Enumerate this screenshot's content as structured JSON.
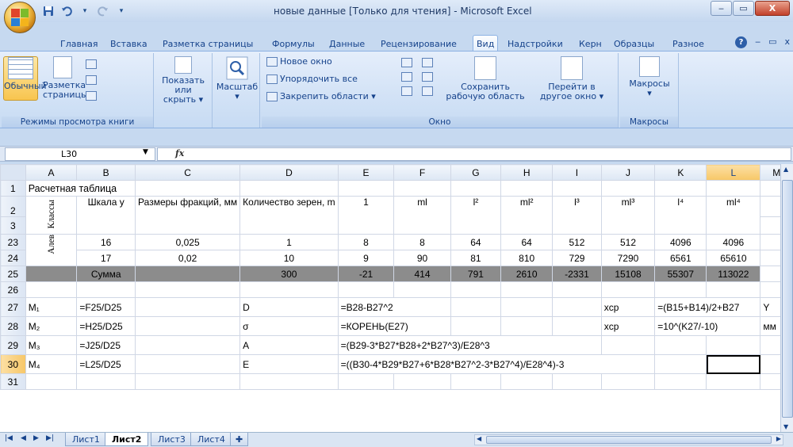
{
  "window": {
    "title": "новые данные  [Только для чтения] - Microsoft Excel",
    "min_label": "‒",
    "max_label": "▭",
    "close_label": "X"
  },
  "qat": {
    "save_icon": "save-icon",
    "undo_icon": "undo-icon",
    "redo_icon": "redo-icon"
  },
  "tabs": [
    {
      "label": "Главная"
    },
    {
      "label": "Вставка"
    },
    {
      "label": "Разметка страницы"
    },
    {
      "label": "Формулы"
    },
    {
      "label": "Данные"
    },
    {
      "label": "Рецензирование"
    },
    {
      "label": "Вид",
      "active": true
    },
    {
      "label": "Надстройки"
    },
    {
      "label": "Керн"
    },
    {
      "label": "Образцы"
    },
    {
      "label": "Разное"
    }
  ],
  "ribbon": {
    "views_group": {
      "label": "Режимы просмотра книги",
      "normal": "Обычный",
      "page_layout_1": "Разметка",
      "page_layout_2": "страницы"
    },
    "show_group": {
      "label_1": "Показать",
      "label_2": "или скрыть ▾"
    },
    "zoom_group": {
      "label": "Масштаб"
    },
    "window_group": {
      "label": "Окно",
      "new_window": "Новое окно",
      "arrange_all": "Упорядочить все",
      "freeze_panes": "Закрепить области ▾",
      "save_workspace_1": "Сохранить",
      "save_workspace_2": "рабочую область",
      "switch_window_1": "Перейти в",
      "switch_window_2": "другое окно ▾"
    },
    "macros_group": {
      "label": "Макросы",
      "button": "Макросы"
    }
  },
  "formula_bar": {
    "name_box": "L30",
    "fx": "fx",
    "formula": ""
  },
  "columns": [
    "A",
    "B",
    "C",
    "D",
    "E",
    "F",
    "G",
    "H",
    "I",
    "J",
    "K",
    "L",
    "M"
  ],
  "rows": {
    "r1": {
      "num": "1",
      "A": "Расчетная таблица"
    },
    "r2": {
      "num": "2",
      "A": "Классы",
      "B": "Шкала y",
      "C": "Размеры фракций, мм",
      "D": "Количество зерен, m",
      "E": "1",
      "F": "ml",
      "G": "l²",
      "H": "ml²",
      "I": "l³",
      "J": "ml³",
      "K": "l⁴",
      "L": "ml⁴"
    },
    "r3": {
      "num": "3"
    },
    "r23": {
      "num": "23",
      "A": "Алев",
      "B": "16",
      "C": "0,025",
      "D": "1",
      "E": "8",
      "F": "8",
      "G": "64",
      "H": "64",
      "I": "512",
      "J": "512",
      "K": "4096",
      "L": "4096"
    },
    "r24": {
      "num": "24",
      "B": "17",
      "C": "0,02",
      "D": "10",
      "E": "9",
      "F": "90",
      "G": "81",
      "H": "810",
      "I": "729",
      "J": "7290",
      "K": "6561",
      "L": "65610"
    },
    "r25": {
      "num": "25",
      "B": "Сумма",
      "D": "300",
      "E": "-21",
      "F": "414",
      "G": "791",
      "H": "2610",
      "I": "-2331",
      "J": "15108",
      "K": "55307",
      "L": "113022"
    },
    "r26": {
      "num": "26"
    },
    "r27": {
      "num": "27",
      "A": "M₁",
      "B": "=F25/D25",
      "D": "D",
      "E": "=B28-B27^2",
      "J": "xср",
      "K": "=(B15+B14)/2+B27",
      "M": "Y"
    },
    "r28": {
      "num": "28",
      "A": "M₂",
      "B": "=H25/D25",
      "D": "σ",
      "E": "=КОРЕНЬ(E27)",
      "J": "xср",
      "K": "=10^(K27/-10)",
      "M": "мм"
    },
    "r29": {
      "num": "29",
      "A": "M₃",
      "B": "=J25/D25",
      "D": "A",
      "E": "=(B29-3*B27*B28+2*B27^3)/E28^3"
    },
    "r30": {
      "num": "30",
      "A": "M₄",
      "B": "=L25/D25",
      "D": "E",
      "E": "=((B30-4*B29*B27+6*B28*B27^2-3*B27^4)/E28^4)-3"
    },
    "r31": {
      "num": "31"
    }
  },
  "sheet_tabs": [
    "Лист1",
    "Лист2",
    "Лист3",
    "Лист4"
  ],
  "active_sheet": "Лист2",
  "colors": {
    "accent": "#15428b",
    "sum_row": "#8c8c8c",
    "selected_header": "#f7c767"
  }
}
